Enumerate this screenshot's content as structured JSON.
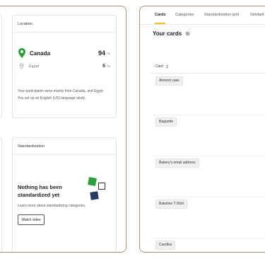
{
  "overview": {
    "location": {
      "title": "Location",
      "rows": [
        {
          "country": "Canada",
          "value": "94",
          "unit": "%"
        },
        {
          "country": "Egypt",
          "value": "6",
          "unit": "%"
        }
      ],
      "note_1": "Your participants were mainly from Canada, and Egypt.",
      "note_2": "You set up an English (US) language study."
    },
    "standardization": {
      "title": "Standardization",
      "heading": "Nothing has been standardized yet",
      "learn_more": "Learn more about standardizing categories.",
      "watch_video": "Watch video"
    }
  },
  "cards_view": {
    "tabs": [
      {
        "label": "Cards",
        "active": true
      },
      {
        "label": "Categories",
        "active": false
      },
      {
        "label": "Standardization grid",
        "active": false
      },
      {
        "label": "Similarit",
        "active": false
      }
    ],
    "heading": "Your cards",
    "column_header": "Card",
    "cards": [
      "Almond cake",
      "Baguette",
      "Bakery's email address",
      "Bakeline T-Shirt",
      "Candles"
    ]
  },
  "colors": {
    "panel_border": "#b08a74",
    "pin_primary": "#2e9e3e",
    "tab_active_underline": "#f0c020",
    "square_green": "#2e9e3e",
    "square_navy": "#283a66"
  },
  "icons": {
    "location_primary": "map-pin-icon",
    "location_secondary": "map-pin-outline-icon",
    "settings": "gear-icon",
    "sort": "sort-icon"
  }
}
